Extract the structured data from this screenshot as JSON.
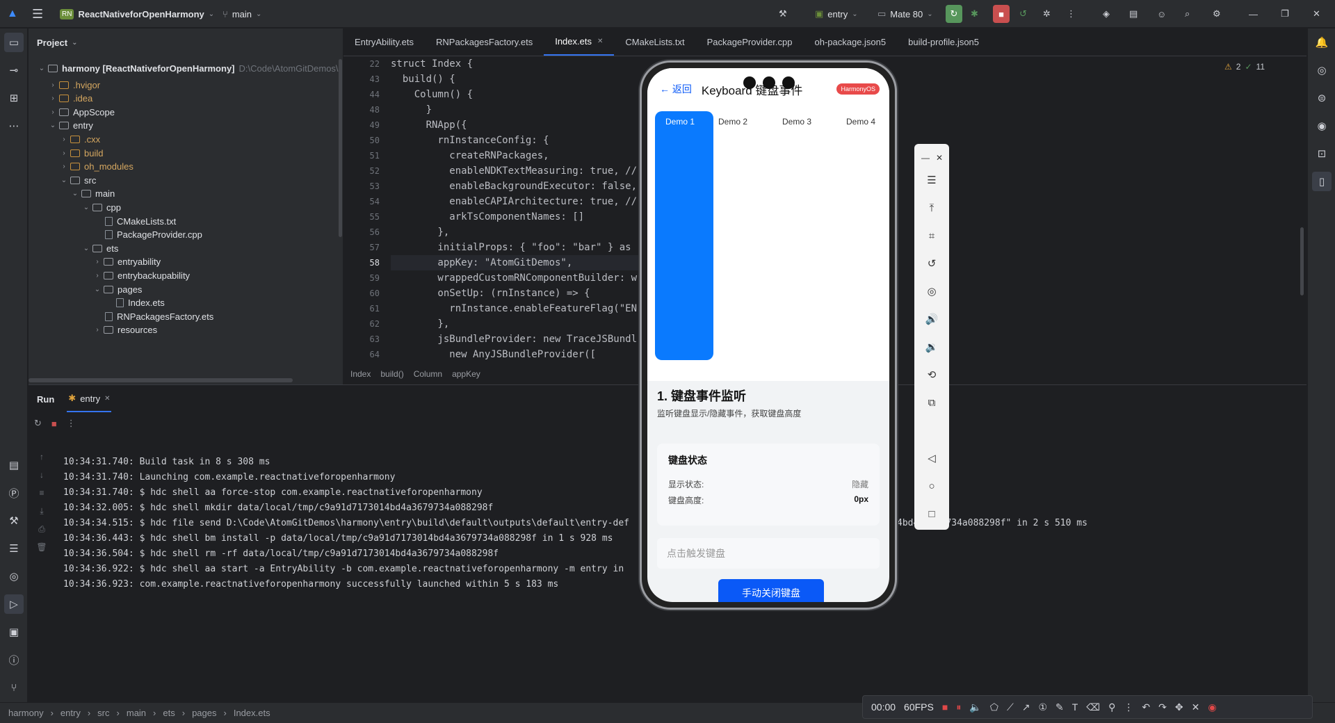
{
  "titlebar": {
    "project_badge": "RN",
    "project_name": "ReactNativeforOpenHarmony",
    "branch": "main",
    "run_config": "entry",
    "device": "Mate 80"
  },
  "project_panel": {
    "title": "Project",
    "root_label": "harmony [ReactNativeforOpenHarmony]",
    "root_path": "D:\\Code\\AtomGitDemos\\",
    "items": [
      {
        "label": ".hvigor",
        "type": "folder-orange"
      },
      {
        "label": ".idea",
        "type": "folder-orange"
      },
      {
        "label": "AppScope",
        "type": "folder"
      },
      {
        "label": "entry",
        "type": "folder"
      },
      {
        "label": ".cxx",
        "type": "folder-orange"
      },
      {
        "label": "build",
        "type": "folder-orange"
      },
      {
        "label": "oh_modules",
        "type": "folder-orange"
      },
      {
        "label": "src",
        "type": "folder"
      },
      {
        "label": "main",
        "type": "folder"
      },
      {
        "label": "cpp",
        "type": "folder"
      },
      {
        "label": "CMakeLists.txt",
        "type": "file"
      },
      {
        "label": "PackageProvider.cpp",
        "type": "file"
      },
      {
        "label": "ets",
        "type": "folder"
      },
      {
        "label": "entryability",
        "type": "folder"
      },
      {
        "label": "entrybackupability",
        "type": "folder"
      },
      {
        "label": "pages",
        "type": "folder"
      },
      {
        "label": "Index.ets",
        "type": "file"
      },
      {
        "label": "RNPackagesFactory.ets",
        "type": "file"
      },
      {
        "label": "resources",
        "type": "folder"
      }
    ]
  },
  "editor": {
    "tabs": [
      "EntryAbility.ets",
      "RNPackagesFactory.ets",
      "Index.ets",
      "CMakeLists.txt",
      "PackageProvider.cpp",
      "oh-package.json5",
      "build-profile.json5"
    ],
    "active_tab": "Index.ets",
    "inspections": {
      "warnings": "2",
      "ok": "11"
    },
    "line_numbers": [
      "22",
      "43",
      "44",
      "48",
      "49",
      "50",
      "51",
      "52",
      "53",
      "54",
      "55",
      "56",
      "57",
      "58",
      "59",
      "60",
      "61",
      "62",
      "63",
      "64"
    ],
    "code_lines": [
      "struct Index {",
      "  build() {",
      "    Column() {",
      "      }",
      "      RNApp({",
      "        rnInstanceConfig: {",
      "          createRNPackages,",
      "          enableNDKTextMeasuring: true, //",
      "          enableBackgroundExecutor: false,",
      "          enableCAPIArchitecture: true, //",
      "          arkTsComponentNames: []",
      "        },",
      "        initialProps: { \"foo\": \"bar\" } as",
      "        appKey: \"AtomGitDemos\",",
      "        wrappedCustomRNComponentBuilder: wr",
      "        onSetUp: (rnInstance) => {",
      "          rnInstance.enableFeatureFlag(\"EN",
      "        },",
      "        jsBundleProvider: new TraceJSBundl",
      "          new AnyJSBundleProvider(["
    ],
    "breadcrumb": [
      "Index",
      "build()",
      "Column",
      "appKey"
    ]
  },
  "run_panel": {
    "tab_run": "Run",
    "tab_entry": "entry",
    "console": [
      "10:34:31.740: Build task in 8 s 308 ms",
      "10:34:31.740: Launching com.example.reactnativeforopenharmony",
      "10:34:31.740: $ hdc shell aa force-stop com.example.reactnativeforopenharmony",
      "10:34:32.005: $ hdc shell mkdir data/local/tmp/c9a91d7173014bd4a3679734a088298f",
      "10:34:34.515: $ hdc file send D:\\Code\\AtomGitDemos\\harmony\\entry\\build\\default\\outputs\\default\\entry-def",
      "10:34:36.443: $ hdc shell bm install -p data/local/tmp/c9a91d7173014bd4a3679734a088298f in 1 s 928 ms",
      "10:34:36.504: $ hdc shell rm -rf data/local/tmp/c9a91d7173014bd4a3679734a088298f",
      "10:34:36.922: $ hdc shell aa start -a EntryAbility -b com.example.reactnativeforopenharmony -m entry in",
      "10:34:36.923: com.example.reactnativeforopenharmony successfully launched within 5 s 183 ms"
    ],
    "console_tail": "4bd4a3679734a088298f\" in 2 s 510 ms"
  },
  "phone": {
    "back_label": "← 返回",
    "title": "Keyboard 键盘事件",
    "badge": "HarmonyOS",
    "demo_tabs": [
      "Demo 1",
      "Demo 2",
      "Demo 3",
      "Demo 4"
    ],
    "section_title": "1. 键盘事件监听",
    "section_sub": "监听键盘显示/隐藏事件，获取键盘高度",
    "card_title": "键盘状态",
    "show_state_label": "显示状态:",
    "show_state_value": "隐藏",
    "height_label": "键盘高度:",
    "height_value": "0px",
    "input_placeholder": "点击触发键盘",
    "button_label": "手动关闭键盘"
  },
  "statusbar": {
    "path": [
      "harmony",
      "entry",
      "src",
      "main",
      "ets",
      "pages",
      "Index.ets"
    ]
  },
  "recorder": {
    "time": "00:00",
    "fps": "60FPS"
  },
  "colors": {
    "accent": "#3574f0",
    "phone_blue": "#0a7afe",
    "badge_red": "#e84a4a"
  }
}
